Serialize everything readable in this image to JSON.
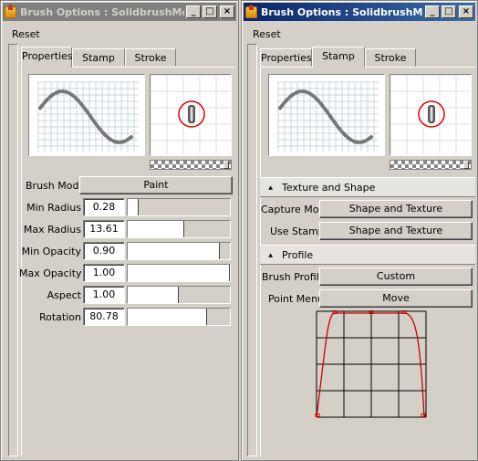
{
  "left_window": {
    "title": "Brush Options : SolidbrushMe...",
    "controls": {
      "minimize": "_",
      "maximize": "□",
      "close": "×"
    },
    "menu": {
      "reset": "Reset"
    },
    "tabs": [
      {
        "label": "Properties",
        "active": true
      },
      {
        "label": "Stamp",
        "active": false
      },
      {
        "label": "Stroke",
        "active": false
      }
    ],
    "properties": {
      "brush_mode": {
        "label": "Brush Mode",
        "value": "Paint"
      },
      "rows": [
        {
          "label": "Min Radius",
          "value": "0.28",
          "fill": 0.0
        },
        {
          "label": "Max Radius",
          "value": "13.61",
          "fill": 0.55
        },
        {
          "label": "Min Opacity",
          "value": "0.90",
          "fill": 0.9
        },
        {
          "label": "Max Opacity",
          "value": "1.00",
          "fill": 1.0
        },
        {
          "label": "Aspect",
          "value": "1.00",
          "fill": 0.5
        },
        {
          "label": "Rotation",
          "value": "80.78",
          "fill": 0.78
        }
      ]
    }
  },
  "right_window": {
    "title": "Brush Options : SolidbrushMe...",
    "controls": {
      "minimize": "_",
      "maximize": "□",
      "close": "×"
    },
    "menu": {
      "reset": "Reset"
    },
    "tabs": [
      {
        "label": "Properties",
        "active": false
      },
      {
        "label": "Stamp",
        "active": true
      },
      {
        "label": "Stroke",
        "active": false
      }
    ],
    "texture_section": {
      "header": "Texture and Shape",
      "capture_mode": {
        "label": "Capture Mode",
        "value": "Shape and Texture"
      },
      "use_stamp": {
        "label": "Use Stamp",
        "value": "Shape and Texture"
      }
    },
    "profile_section": {
      "header": "Profile",
      "brush_profile": {
        "label": "Brush Profile",
        "value": "Custom"
      },
      "point_menu": {
        "label": "Point Menu",
        "value": "Move"
      }
    }
  },
  "colors": {
    "active_title": "#0a246a",
    "inactive_title": "#808080",
    "curve": "#cc0000",
    "ring": "#e00000"
  },
  "icons": [
    "app-icon",
    "minimize-icon",
    "maximize-icon",
    "close-icon",
    "collapse-icon"
  ]
}
